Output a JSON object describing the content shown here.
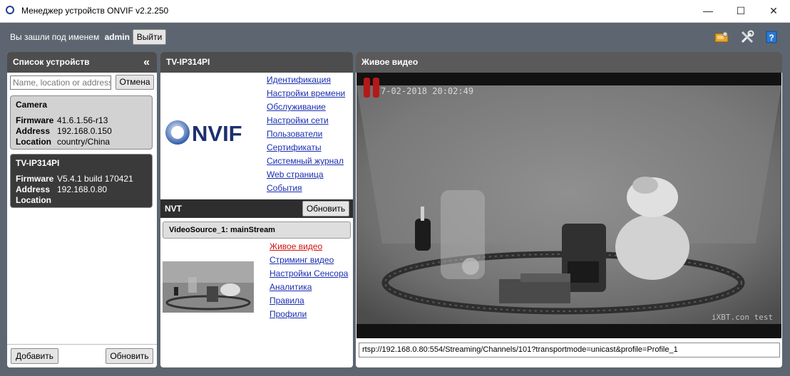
{
  "window": {
    "title": "Менеджер устройств ONVIF v2.2.250",
    "minimize": "—",
    "maximize": "☐",
    "close": "✕"
  },
  "topbar": {
    "login_prefix": "Вы зашли под именем",
    "username": "admin",
    "logout_label": "Выйти",
    "icons": [
      "network-icon",
      "tools-icon",
      "help-icon"
    ]
  },
  "devices_panel": {
    "title": "Список устройств",
    "collapse_glyph": "«",
    "search_placeholder": "Name, location or address",
    "cancel_label": "Отмена",
    "add_label": "Добавить",
    "refresh_label": "Обновить",
    "field_labels": {
      "firmware": "Firmware",
      "address": "Address",
      "location": "Location"
    },
    "devices": [
      {
        "name": "Camera",
        "firmware": "41.6.1.56-r13",
        "address": "192.168.0.150",
        "location": "country/China"
      },
      {
        "name": "TV-IP314PI",
        "firmware": "V5.4.1 build 170421",
        "address": "192.168.0.80",
        "location": ""
      }
    ]
  },
  "device_panel": {
    "title": "TV-IP314PI",
    "logo_text": "NVIF",
    "menu": [
      "Идентификация",
      "Настройки времени",
      "Обслуживание",
      "Настройки сети",
      "Пользователи",
      "Сертификаты",
      "Системный журнал",
      "Web страница",
      "События"
    ],
    "nvt_label": "NVT",
    "nvt_refresh_label": "Обновить",
    "video_source": "VideoSource_1: mainStream",
    "nvt_menu": [
      "Живое видео",
      "Стриминг видео",
      "Настройки Сенсора",
      "Аналитика",
      "Правила",
      "Профили"
    ],
    "nvt_active_index": 0
  },
  "live_panel": {
    "title": "Живое видео",
    "timestamp": "7-02-2018 20:02:49",
    "watermark": "iXBT.con test",
    "rtsp_url": "rtsp://192.168.0.80:554/Streaming/Channels/101?transportmode=unicast&profile=Profile_1"
  }
}
